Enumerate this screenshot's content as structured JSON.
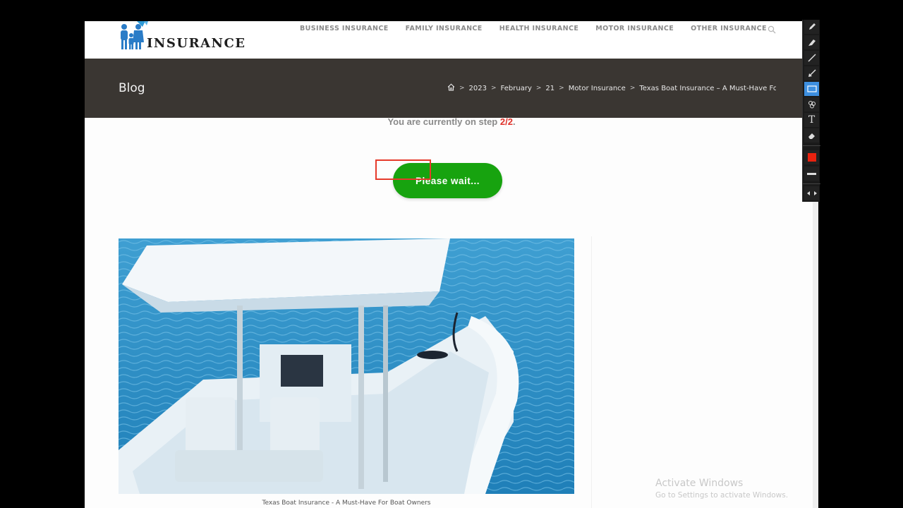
{
  "header": {
    "logo_text": "INSURANCE",
    "logo_icon": "family-umbrella-icon",
    "nav": [
      {
        "label": "BUSINESS INSURANCE"
      },
      {
        "label": "FAMILY INSURANCE"
      },
      {
        "label": "HEALTH INSURANCE"
      },
      {
        "label": "MOTOR INSURANCE"
      },
      {
        "label": "OTHER INSURANCE"
      }
    ],
    "search_icon": "search-icon"
  },
  "title_bar": {
    "title": "Blog",
    "breadcrumb": {
      "home_icon": "home-icon",
      "separator": ">",
      "items": [
        "2023",
        "February",
        "21",
        "Motor Insurance",
        "Texas Boat Insurance – A Must-Have For Boat Owners"
      ]
    }
  },
  "step": {
    "prefix": "You are currently on step ",
    "value": "2/2",
    "suffix": "."
  },
  "wait_button": {
    "label": "Please wait..."
  },
  "featured_image": {
    "alt": "White center-console boat on blue water",
    "caption": "Texas Boat Insurance - A Must-Have For Boat Owners"
  },
  "activate_windows": {
    "title": "Activate Windows",
    "subtitle": "Go to Settings to activate Windows."
  },
  "colors": {
    "accent_green": "#17a30f",
    "step_red": "#e0322b",
    "title_bar_bg": "#3a3632",
    "annotation_red": "#e63a2b",
    "toolbar_active": "#3d8fe0"
  },
  "annotation_toolbar": {
    "tools": [
      {
        "name": "pencil",
        "active": false
      },
      {
        "name": "marker",
        "active": false
      },
      {
        "name": "line",
        "active": false
      },
      {
        "name": "arrow",
        "active": false
      },
      {
        "name": "rectangle",
        "active": true
      },
      {
        "name": "highlighter-shapes",
        "active": false
      },
      {
        "name": "text",
        "label": "T",
        "active": false
      },
      {
        "name": "eraser",
        "active": false
      },
      {
        "name": "color-red",
        "active": false
      },
      {
        "name": "line-width",
        "active": false
      },
      {
        "name": "move-toolbar",
        "active": false
      }
    ]
  }
}
